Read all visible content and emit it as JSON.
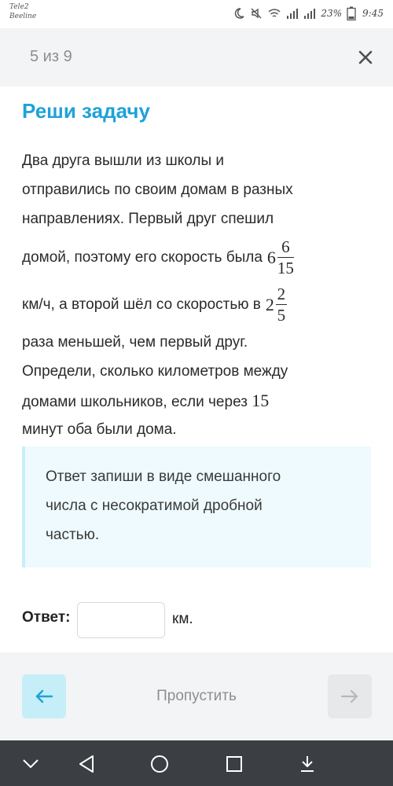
{
  "status_bar": {
    "carrier_line1": "Tele2",
    "carrier_line2": "Beeline",
    "battery_percent": "23%",
    "time": "9:45"
  },
  "header": {
    "counter": "5 из 9"
  },
  "task": {
    "title": "Реши задачу",
    "line1": "Два друга вышли из школы и",
    "line2": "отправились по своим домам в разных",
    "line3": "направлениях. Первый друг спешил",
    "line4_text": "домой, поэтому его скорость была",
    "speed1_whole": "6",
    "speed1_num": "6",
    "speed1_den": "15",
    "line5_text": "км/ч, а второй шёл со скоростью в",
    "ratio_whole": "2",
    "ratio_num": "2",
    "ratio_den": "5",
    "line6": "раза меньшей, чем первый друг.",
    "line7": "Определи, сколько километров между",
    "line8_text": "домами школьников, если через",
    "minutes": "15",
    "line9": "минут оба были дома."
  },
  "hint": {
    "line1": "Ответ запиши в виде смешанного",
    "line2": "числа с несократимой дробной",
    "line3": "частью."
  },
  "answer": {
    "label": "Ответ:",
    "value": "",
    "unit": "км."
  },
  "actions": {
    "skip_label": "Пропустить"
  },
  "colors": {
    "accent": "#1fa2d8",
    "back_button_bg": "#c6eef8",
    "hint_bg": "#eefafd"
  }
}
